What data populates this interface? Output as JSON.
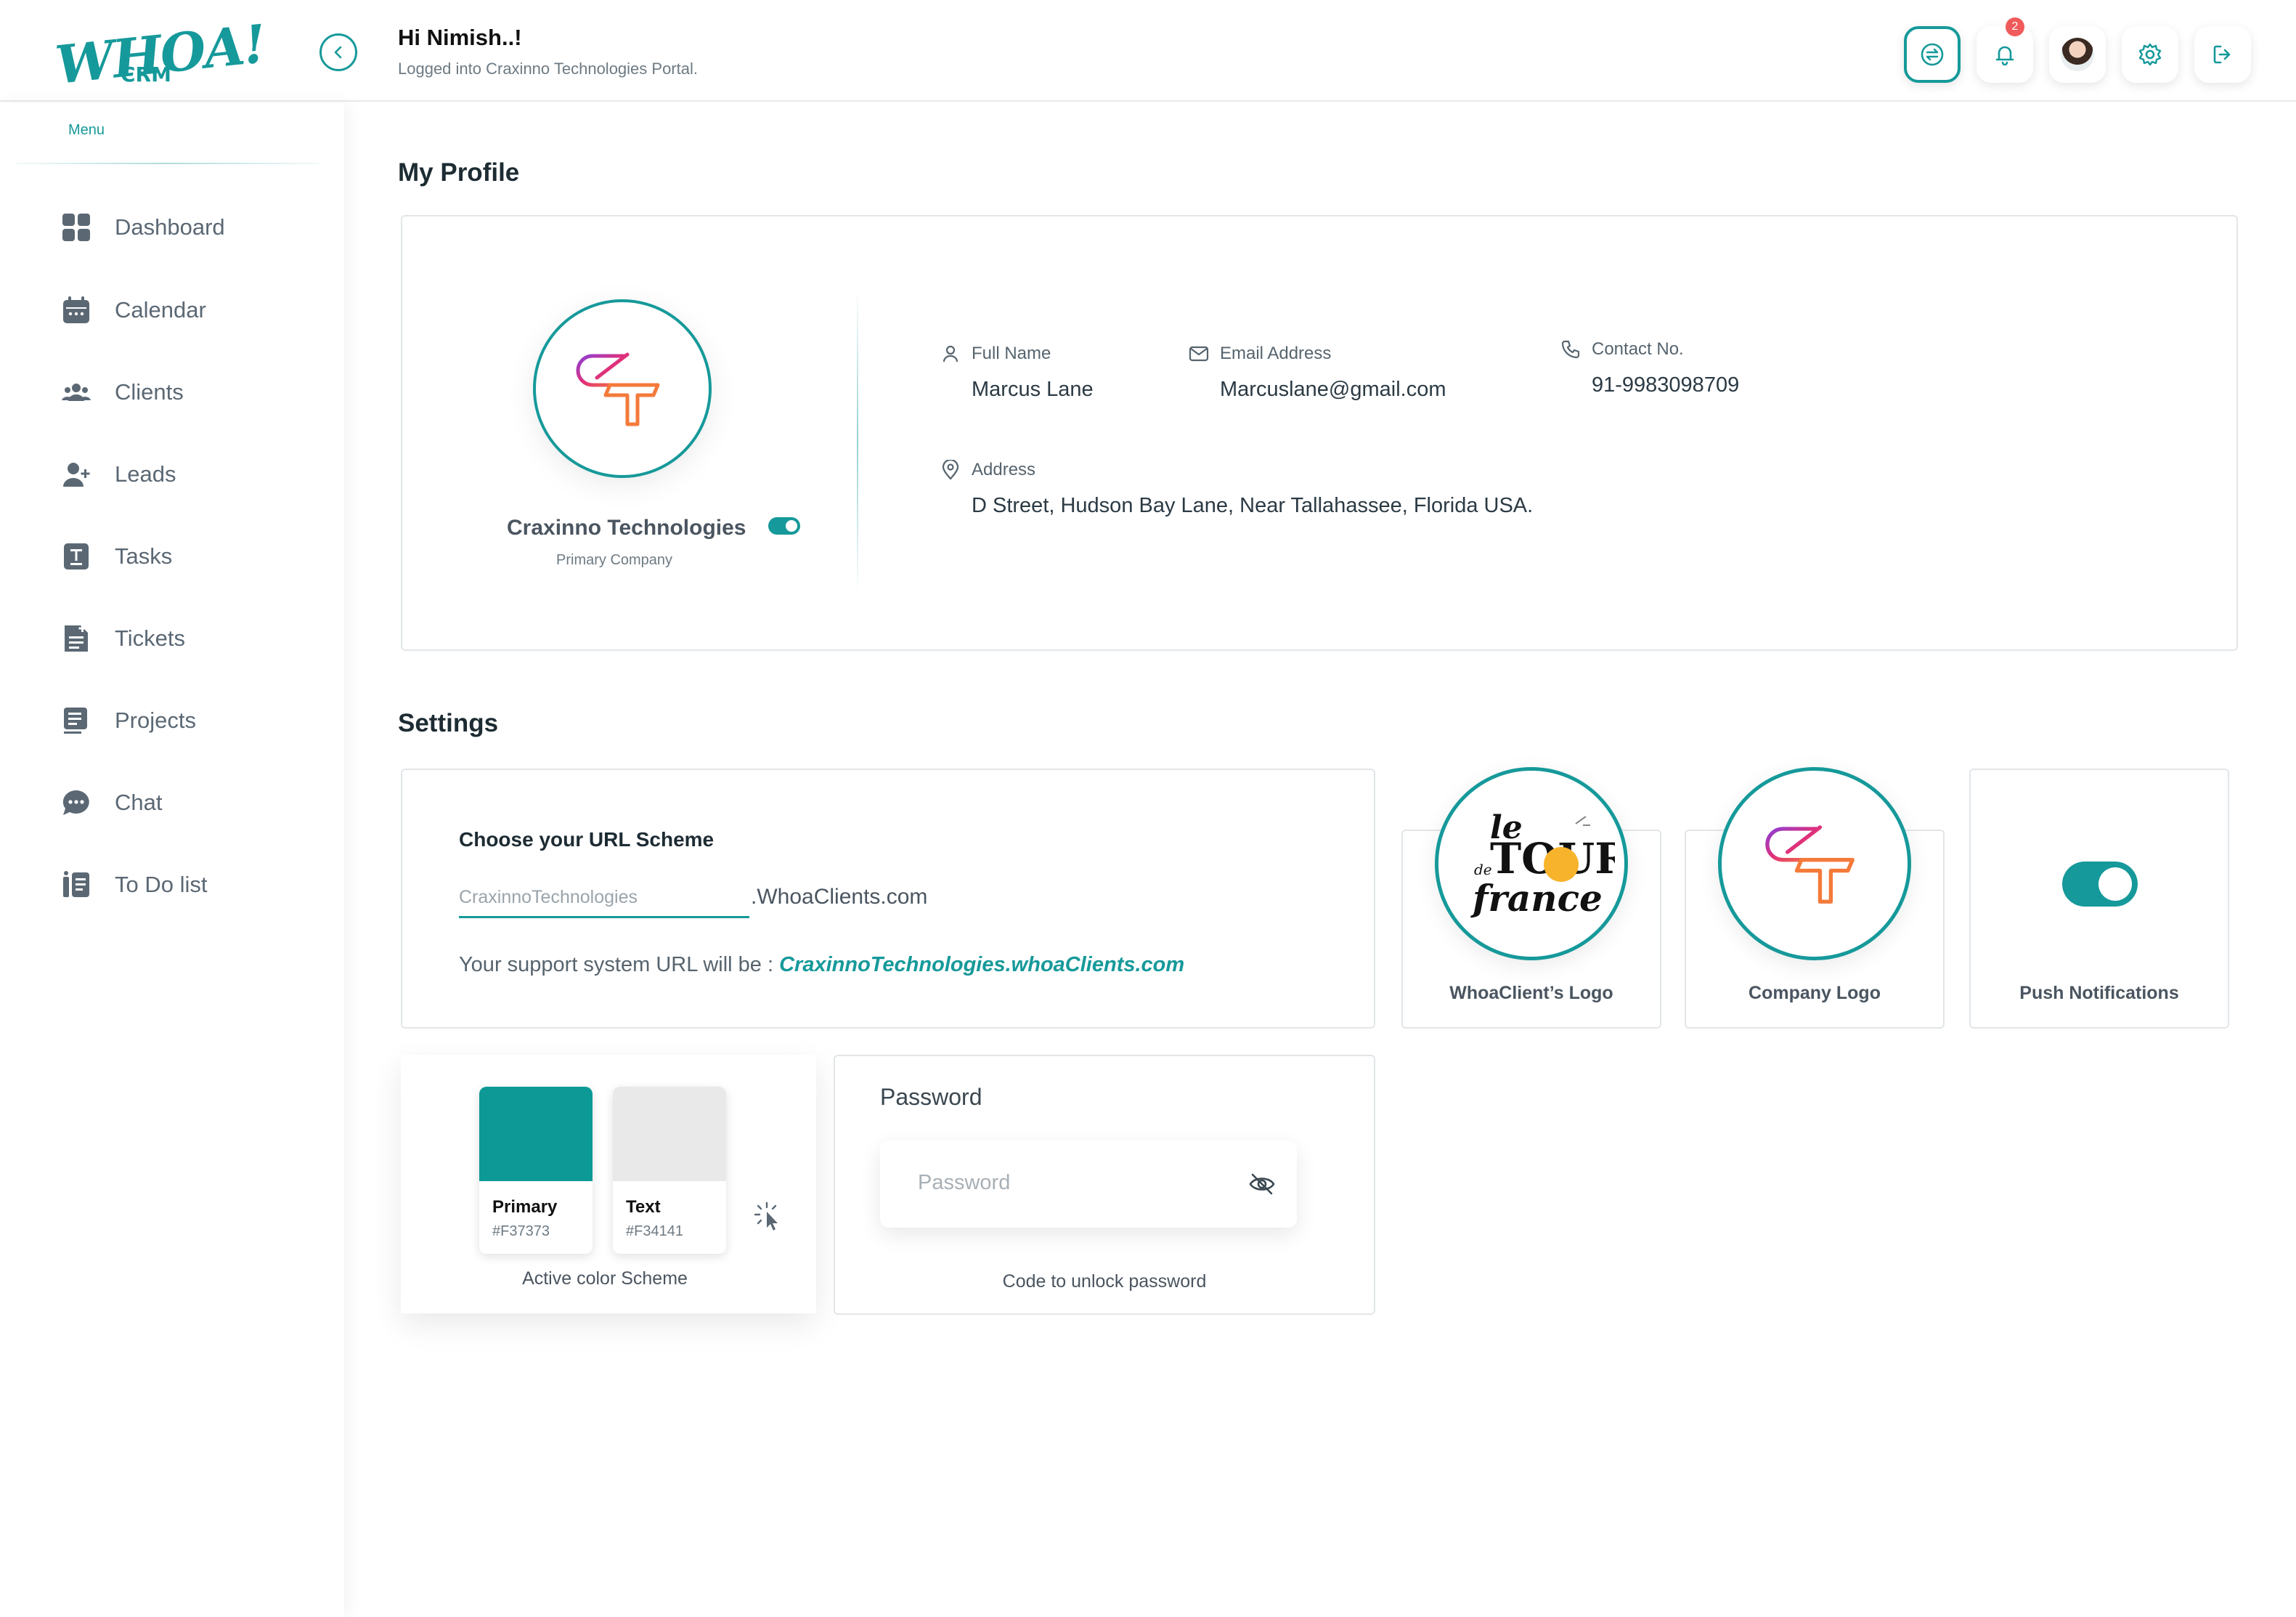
{
  "header": {
    "logo_text": "WHOA!",
    "logo_sub": "CRM",
    "greeting_title": "Hi Nimish..!",
    "greeting_subtitle": "Logged into Craxinno Technologies Portal.",
    "notification_count": "2",
    "icons": [
      "switch-icon",
      "bell-icon",
      "avatar",
      "gear-icon",
      "logout-icon"
    ]
  },
  "sidebar": {
    "menu_label": "Menu",
    "items": [
      {
        "label": "Dashboard",
        "icon": "dashboard-icon"
      },
      {
        "label": "Calendar",
        "icon": "calendar-icon"
      },
      {
        "label": "Clients",
        "icon": "clients-icon"
      },
      {
        "label": "Leads",
        "icon": "leads-icon"
      },
      {
        "label": "Tasks",
        "icon": "tasks-icon"
      },
      {
        "label": "Tickets",
        "icon": "tickets-icon"
      },
      {
        "label": "Projects",
        "icon": "projects-icon"
      },
      {
        "label": "Chat",
        "icon": "chat-icon"
      },
      {
        "label": "To Do list",
        "icon": "todo-icon"
      }
    ]
  },
  "profile": {
    "section_title": "My Profile",
    "company_name": "Craxinno Technologies",
    "company_role": "Primary Company",
    "primary_toggle_on": true,
    "full_name_label": "Full Name",
    "full_name": "Marcus Lane",
    "email_label": "Email Address",
    "email": "Marcuslane@gmail.com",
    "contact_label": "Contact No.",
    "contact": "91-9983098709",
    "address_label": "Address",
    "address": "D Street, Hudson Bay Lane, Near Tallahassee, Florida USA."
  },
  "settings": {
    "section_title": "Settings",
    "url_title": "Choose your URL Scheme",
    "url_placeholder": "CraxinnoTechnologies",
    "url_suffix": ".WhoaClients.com",
    "support_prefix": "Your support system URL will be : ",
    "support_url": "CraxinnoTechnologies.whoaClients.com",
    "client_logo_label": "WhoaClient’s Logo",
    "company_logo_label": "Company Logo",
    "push_label": "Push Notifications",
    "push_enabled": true,
    "colors": {
      "primary_name": "Primary",
      "primary_hex": "#F37373",
      "primary_swatch_color": "#0d9a97",
      "text_name": "Text",
      "text_hex": "#F34141",
      "text_swatch_color": "#e9e9e9",
      "label": "Active color Scheme"
    },
    "password": {
      "title": "Password",
      "placeholder": "Password",
      "hint": "Code to unlock password"
    }
  },
  "client_logo": {
    "line1": "le",
    "line2": "TOUR",
    "line3": "de",
    "line4": "france"
  },
  "theme": {
    "accent": "#16999a",
    "badge": "#f05a5a"
  }
}
